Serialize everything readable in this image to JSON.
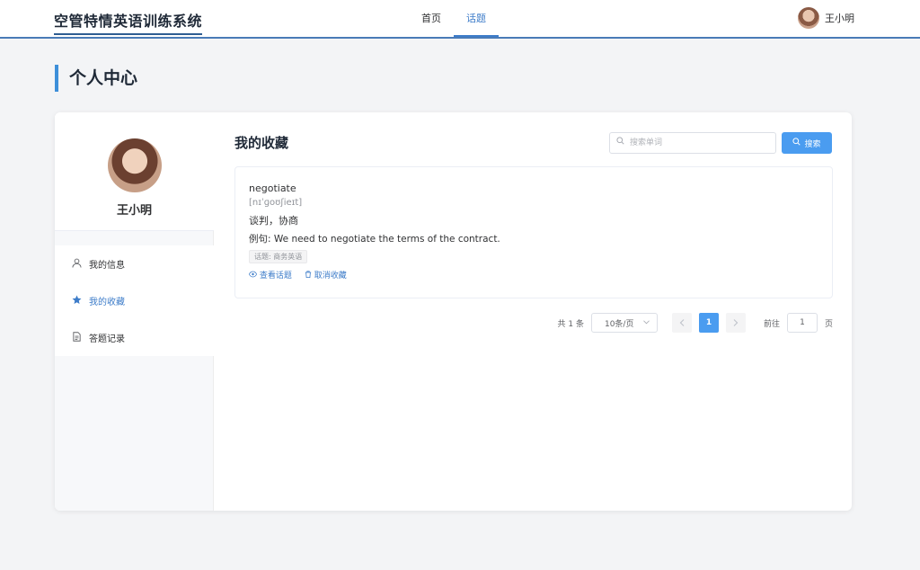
{
  "header": {
    "brand": "空管特情英语训练系统",
    "nav": [
      {
        "label": "首页",
        "active": false
      },
      {
        "label": "话题",
        "active": true
      }
    ],
    "user_name": "王小明"
  },
  "page_title": "个人中心",
  "sidebar": {
    "profile_name": "王小明",
    "menu": [
      {
        "label": "我的信息",
        "icon": "user-icon",
        "active": false
      },
      {
        "label": "我的收藏",
        "icon": "star-icon",
        "active": true
      },
      {
        "label": "答题记录",
        "icon": "document-icon",
        "active": false
      }
    ]
  },
  "favorites": {
    "title": "我的收藏",
    "search_placeholder": "搜索单词",
    "search_button": "搜索",
    "items": [
      {
        "word": "negotiate",
        "phonetic": "[nɪˈɡoʊʃieɪt]",
        "meaning": "谈判，协商",
        "example": "例句: We need to negotiate the terms of the contract.",
        "topic_tag": "话题: 商务英语",
        "view_label": "查看话题",
        "remove_label": "取消收藏"
      }
    ]
  },
  "pagination": {
    "total": "共 1 条",
    "page_size": "10条/页",
    "current_page": "1",
    "goto_label": "前往",
    "goto_value": "1",
    "page_unit": "页"
  },
  "colors": {
    "accent": "#3d7cc9",
    "button": "#4a9cf0",
    "title_bar": "#3d8fd9"
  }
}
